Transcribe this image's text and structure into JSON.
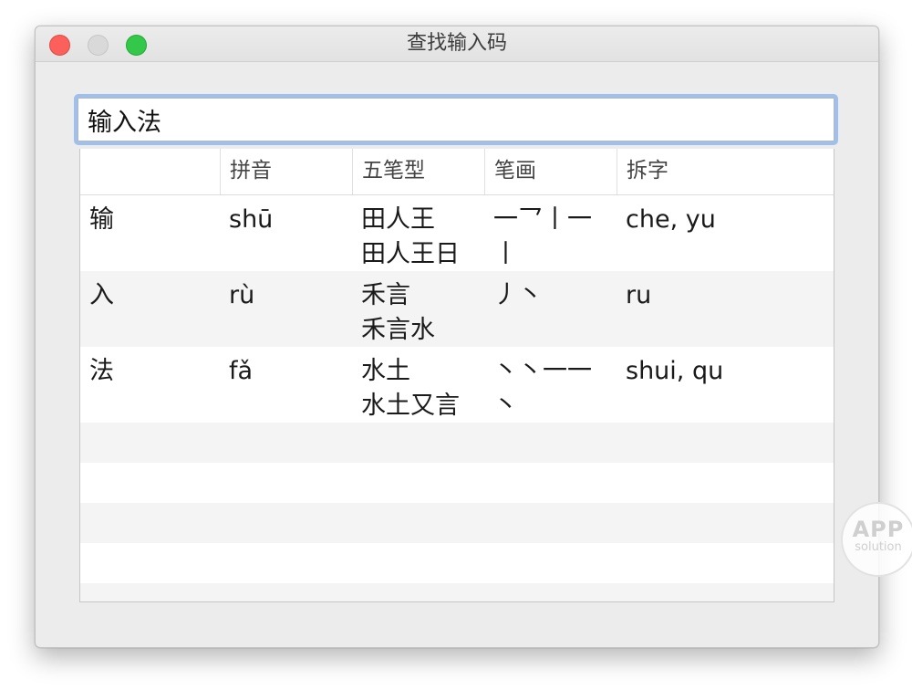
{
  "window": {
    "title": "查找输入码"
  },
  "search": {
    "value": "输入法"
  },
  "table": {
    "headers": [
      "",
      "拼音",
      "五笔型",
      "笔画",
      "拆字"
    ],
    "rows": [
      {
        "char": "输",
        "pinyin": "shū",
        "wubi": "田人王\n田人王日",
        "strokes": "一乛丨一\n丨",
        "chaizi": "che, yu"
      },
      {
        "char": "入",
        "pinyin": "rù",
        "wubi": "禾言\n禾言水",
        "strokes": "丿丶",
        "chaizi": "ru"
      },
      {
        "char": "法",
        "pinyin": "fǎ",
        "wubi": "水土\n水土又言",
        "strokes": "丶丶一一\n丶",
        "chaizi": "shui, qu"
      }
    ]
  },
  "watermark": {
    "line1": "APP",
    "line2": "solution"
  }
}
